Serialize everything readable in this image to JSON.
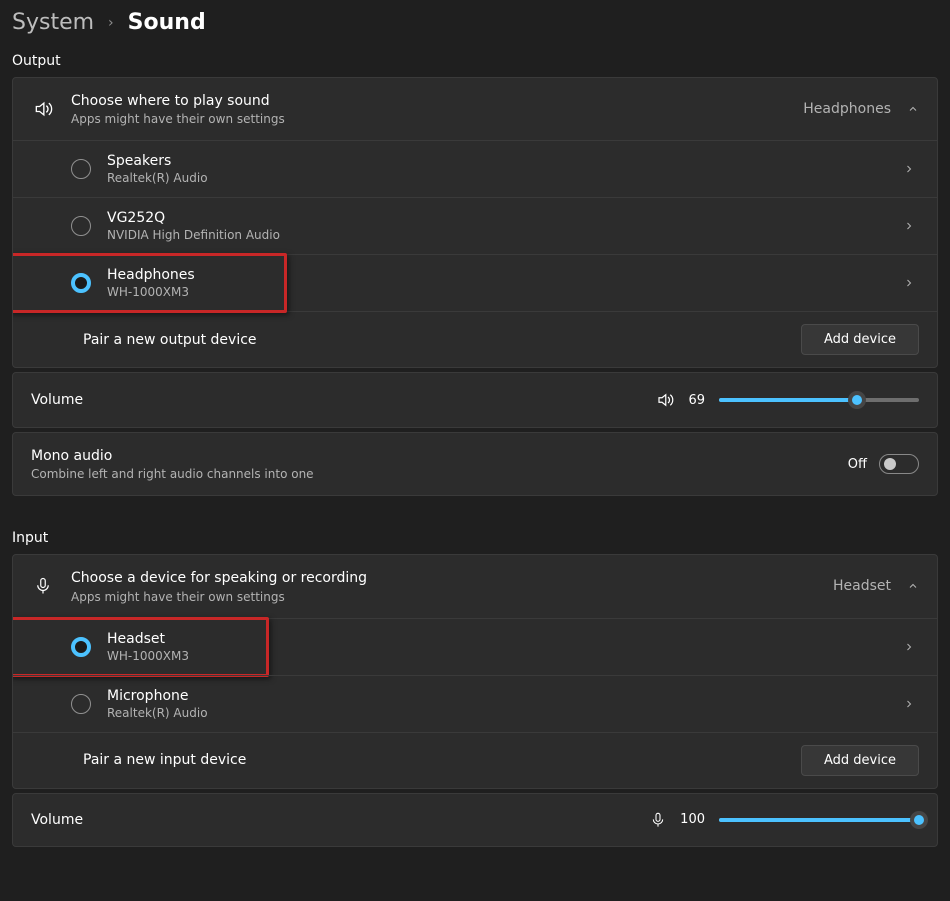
{
  "breadcrumb": {
    "parent": "System",
    "current": "Sound"
  },
  "output": {
    "section_title": "Output",
    "header": {
      "title": "Choose where to play sound",
      "sub": "Apps might have their own settings",
      "current": "Headphones"
    },
    "devices": [
      {
        "name": "Speakers",
        "sub": "Realtek(R) Audio",
        "selected": false,
        "highlight": false
      },
      {
        "name": "VG252Q",
        "sub": "NVIDIA High Definition Audio",
        "selected": false,
        "highlight": false
      },
      {
        "name": "Headphones",
        "sub": "WH-1000XM3",
        "selected": true,
        "highlight": true,
        "hl_width": 278
      }
    ],
    "pair": {
      "label": "Pair a new output device",
      "button": "Add device"
    },
    "volume": {
      "label": "Volume",
      "value": 69
    },
    "mono": {
      "title": "Mono audio",
      "sub": "Combine left and right audio channels into one",
      "state": "Off",
      "on": false
    }
  },
  "input": {
    "section_title": "Input",
    "header": {
      "title": "Choose a device for speaking or recording",
      "sub": "Apps might have their own settings",
      "current": "Headset"
    },
    "devices": [
      {
        "name": "Headset",
        "sub": "WH-1000XM3",
        "selected": true,
        "highlight": true,
        "hl_width": 260
      },
      {
        "name": "Microphone",
        "sub": "Realtek(R) Audio",
        "selected": false,
        "highlight": false
      }
    ],
    "pair": {
      "label": "Pair a new input device",
      "button": "Add device"
    },
    "volume": {
      "label": "Volume",
      "value": 100
    }
  }
}
